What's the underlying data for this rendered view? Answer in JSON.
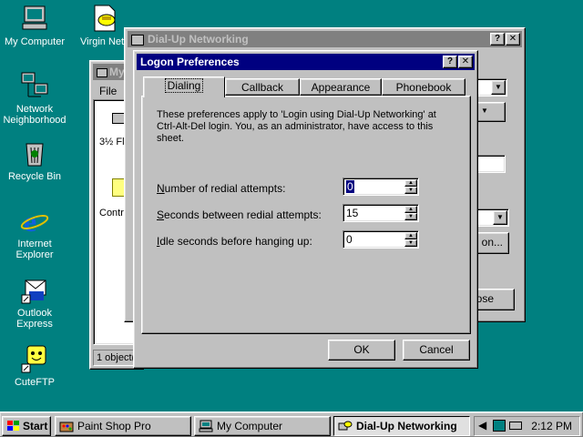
{
  "desktop": {
    "icons": [
      {
        "label": "My Computer"
      },
      {
        "label": "Virgin Net"
      },
      {
        "label": "Network Neighborhood"
      },
      {
        "label": "Recycle Bin"
      },
      {
        "label": "Internet Explorer"
      },
      {
        "label": "Outlook Express"
      },
      {
        "label": "CuteFTP"
      }
    ]
  },
  "my_computer": {
    "title": "My",
    "menu_file": "File",
    "item1": "3½ Fl",
    "item2": "Contr",
    "status": "1 object(s"
  },
  "dialup": {
    "title": "Dial-Up Networking",
    "button_partial1": "on...",
    "button_partial2": "ose"
  },
  "dialog": {
    "title": "Logon Preferences",
    "tabs": [
      "Dialing",
      "Callback",
      "Appearance",
      "Phonebook"
    ],
    "description": "These preferences apply to 'Login using Dial-Up Networking' at Ctrl-Alt-Del login.  You, as an administrator, have access to this sheet.",
    "fields": [
      {
        "label": "Number of redial attempts:",
        "value": "0"
      },
      {
        "label": "Seconds between redial attempts:",
        "value": "15"
      },
      {
        "label": "Idle seconds before hanging up:",
        "value": "0"
      }
    ],
    "ok": "OK",
    "cancel": "Cancel"
  },
  "taskbar": {
    "start": "Start",
    "tasks": [
      "Paint Shop Pro",
      "My Computer",
      "Dial-Up Networking"
    ],
    "clock": "2:12 PM"
  }
}
